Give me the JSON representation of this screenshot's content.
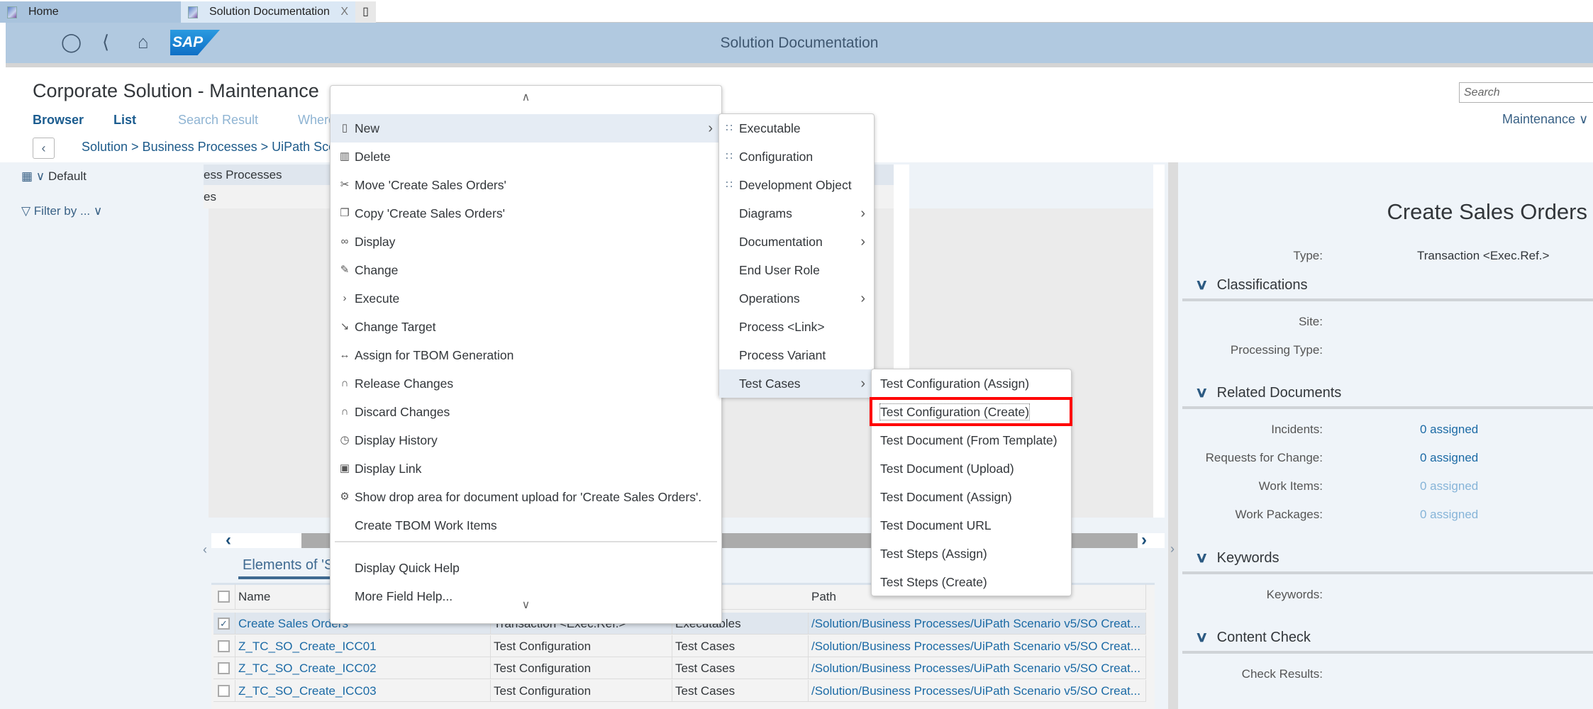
{
  "browser_tabs": [
    {
      "label": "Home"
    },
    {
      "label": "Solution Documentation",
      "close": "X"
    }
  ],
  "shell": {
    "title": "Solution Documentation",
    "logo": "SAP",
    "icons": [
      "user-icon",
      "back-icon",
      "home-icon"
    ]
  },
  "page": {
    "title": "Corporate Solution - Maintenance",
    "nav_tabs": [
      {
        "label": "Browser",
        "color": "#1b5c8f"
      },
      {
        "label": "List",
        "color": "#1b5c8f"
      },
      {
        "label": "Search Result",
        "color": "#8fb4d3"
      },
      {
        "label": "Where",
        "color": "#8fb4d3"
      }
    ],
    "breadcrumb": "Solution > Business Processes > UiPath Scena",
    "search_placeholder": "Search",
    "maintenance": "Maintenance ∨"
  },
  "left": {
    "view": "Default",
    "filter": "Filter by ... ∨"
  },
  "tree": {
    "header": "ess Processes",
    "row": "es"
  },
  "elements_tab": "Elements of 'S",
  "table": {
    "headers": {
      "name": "Name",
      "path": "Path"
    },
    "rows": [
      {
        "checked": true,
        "name": "Create Sales Orders",
        "type": "Transaction <Exec.Ref.>",
        "category": "Executables",
        "path": "/Solution/Business Processes/UiPath Scenario v5/SO Creat..."
      },
      {
        "checked": false,
        "name": "Z_TC_SO_Create_ICC01",
        "type": "Test Configuration",
        "category": "Test Cases",
        "path": "/Solution/Business Processes/UiPath Scenario v5/SO Creat..."
      },
      {
        "checked": false,
        "name": "Z_TC_SO_Create_ICC02",
        "type": "Test Configuration",
        "category": "Test Cases",
        "path": "/Solution/Business Processes/UiPath Scenario v5/SO Creat..."
      },
      {
        "checked": false,
        "name": "Z_TC_SO_Create_ICC03",
        "type": "Test Configuration",
        "category": "Test Cases",
        "path": "/Solution/Business Processes/UiPath Scenario v5/SO Creat..."
      }
    ]
  },
  "context_menu": {
    "items": [
      {
        "label": "New",
        "icon": "new-document-icon",
        "glyph": "▯",
        "submenu": true,
        "highlighted": true
      },
      {
        "label": "Delete",
        "icon": "trash-icon",
        "glyph": "▥"
      },
      {
        "label": "Move 'Create Sales Orders'",
        "icon": "scissors-icon",
        "glyph": "✂"
      },
      {
        "label": "Copy 'Create Sales Orders'",
        "icon": "copy-icon",
        "glyph": "❐"
      },
      {
        "label": "Display",
        "icon": "glasses-icon",
        "glyph": "∞"
      },
      {
        "label": "Change",
        "icon": "pencil-icon",
        "glyph": "✎"
      },
      {
        "label": "Execute",
        "icon": "chevron-right-icon",
        "glyph": "›"
      },
      {
        "label": "Change Target",
        "icon": "target-link-icon",
        "glyph": "↘"
      },
      {
        "label": "Assign for TBOM Generation",
        "icon": "assign-arrows-icon",
        "glyph": "↔"
      },
      {
        "label": "Release Changes",
        "icon": "headset-icon",
        "glyph": "∩"
      },
      {
        "label": "Discard Changes",
        "icon": "headset-icon",
        "glyph": "∩"
      },
      {
        "label": "Display History",
        "icon": "history-icon",
        "glyph": "◷"
      },
      {
        "label": "Display Link",
        "icon": "link-icon",
        "glyph": "▣"
      },
      {
        "label": "Show drop area for document upload for 'Create Sales Orders'.",
        "icon": "upload-settings-icon",
        "glyph": "⚙"
      },
      {
        "label": "Create TBOM Work Items"
      },
      {
        "label": "Display Quick Help",
        "separator_before": true
      },
      {
        "label": "More Field Help..."
      }
    ],
    "scroll_up": "∧",
    "scroll_down": "∨"
  },
  "new_submenu": {
    "items": [
      {
        "label": "Executable",
        "icon": "object-list-icon",
        "glyph": "∷"
      },
      {
        "label": "Configuration",
        "icon": "object-list-icon",
        "glyph": "∷"
      },
      {
        "label": "Development Object",
        "icon": "object-list-icon",
        "glyph": "∷"
      },
      {
        "label": "Diagrams",
        "submenu": true
      },
      {
        "label": "Documentation",
        "submenu": true
      },
      {
        "label": "End User Role"
      },
      {
        "label": "Operations",
        "submenu": true
      },
      {
        "label": "Process <Link>"
      },
      {
        "label": "Process Variant"
      },
      {
        "label": "Test Cases",
        "submenu": true,
        "highlighted": true
      }
    ]
  },
  "test_cases_submenu": {
    "items": [
      {
        "label": "Test Configuration (Assign)"
      },
      {
        "label": "Test Configuration (Create)",
        "focused": true
      },
      {
        "label": "Test Document (From Template)"
      },
      {
        "label": "Test Document (Upload)"
      },
      {
        "label": "Test Document (Assign)"
      },
      {
        "label": "Test Document URL"
      },
      {
        "label": "Test Steps (Assign)"
      },
      {
        "label": "Test Steps (Create)"
      }
    ]
  },
  "details": {
    "title": "Create Sales Orders",
    "type_label": "Type:",
    "type_value": "Transaction <Exec.Ref.>",
    "sections": [
      {
        "title": "Classifications",
        "fields": [
          {
            "label": "Site:",
            "value": ""
          },
          {
            "label": "Processing Type:",
            "value": ""
          }
        ]
      },
      {
        "title": "Related Documents",
        "fields": [
          {
            "label": "Incidents:",
            "value": "0 assigned",
            "active": true
          },
          {
            "label": "Requests for Change:",
            "value": "0 assigned",
            "active": true
          },
          {
            "label": "Work Items:",
            "value": "0 assigned",
            "active": false
          },
          {
            "label": "Work Packages:",
            "value": "0 assigned",
            "active": false
          }
        ]
      },
      {
        "title": "Keywords",
        "fields": [
          {
            "label": "Keywords:",
            "value": ""
          }
        ]
      },
      {
        "title": "Content Check",
        "fields": [
          {
            "label": "Check Results:",
            "value": ""
          }
        ]
      }
    ]
  },
  "colors": {
    "shell": "#b1c9e0",
    "link": "#1b6aa5",
    "highlight": "#e5ecf4",
    "focus_box": "#ff0000"
  }
}
